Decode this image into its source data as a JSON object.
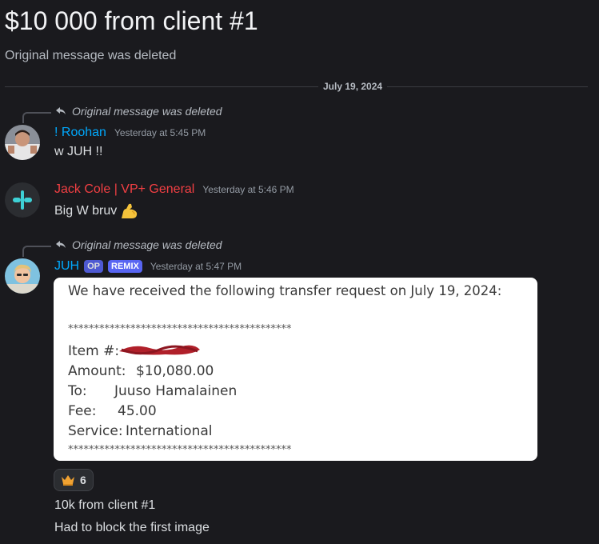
{
  "thread": {
    "title": "$10 000 from client #1",
    "subtitle": "Original message was deleted"
  },
  "divider": {
    "date": "July 19, 2024"
  },
  "messages": [
    {
      "reply_text": "Original message was deleted",
      "username": "! Roohan",
      "username_color": "#00a8fc",
      "timestamp": "Yesterday at 5:45 PM",
      "text": "w JUH !!"
    },
    {
      "username": "Jack Cole | VP+ General",
      "username_color": "#f23f43",
      "timestamp": "Yesterday at 5:46 PM",
      "text": "Big W bruv",
      "emoji": "flexed-biceps"
    },
    {
      "reply_text": "Original message was deleted",
      "username": "JUH",
      "username_color": "#00a8fc",
      "tags": [
        "OP",
        "REMIX"
      ],
      "timestamp": "Yesterday at 5:47 PM",
      "attachment": {
        "heading": "We have received the following transfer request on July 19, 2024:",
        "stars_top": "*******************************************",
        "item_label": "Item #:",
        "amount_label": "Amount:",
        "amount_value": "$10,080.00",
        "to_label": "To:",
        "to_value": "Juuso Hamalainen",
        "fee_label": "Fee:",
        "fee_value": "45.00",
        "service_label": "Service:",
        "service_value": "International",
        "stars_bottom": "*******************************************"
      },
      "reaction": {
        "icon": "crown-icon",
        "count": "6"
      },
      "lines": [
        "10k from client #1",
        "Had to block the first image"
      ]
    }
  ]
}
